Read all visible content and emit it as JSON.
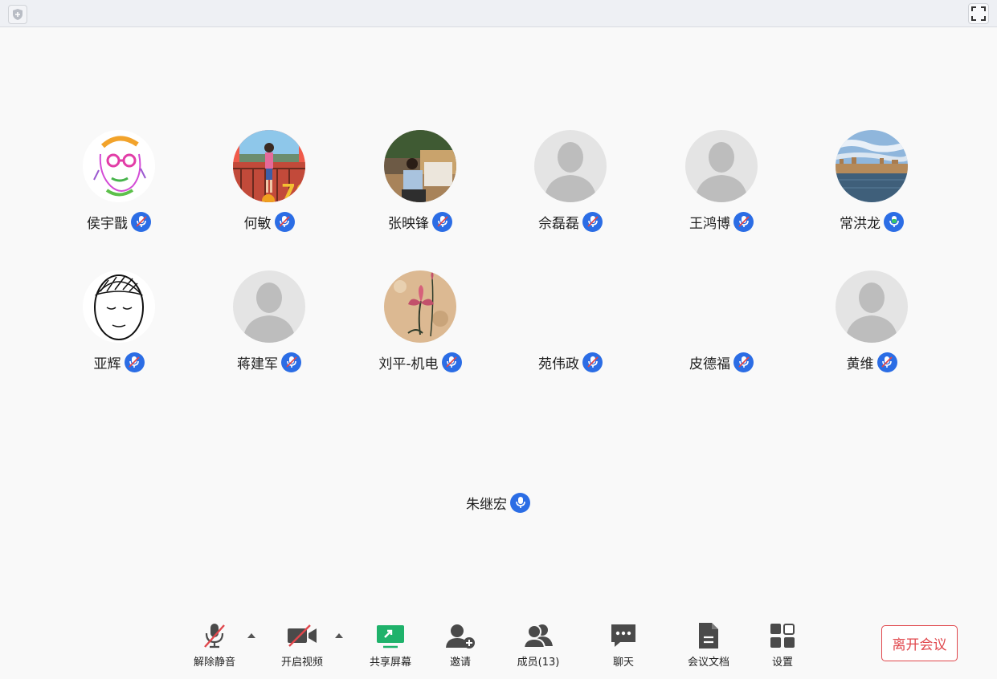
{
  "participants": [
    {
      "name": "侯宇戬",
      "mic": "muted",
      "avatar": "sketch-face-icon"
    },
    {
      "name": "何敏",
      "mic": "muted",
      "avatar": "photo-person-icon"
    },
    {
      "name": "张映锋",
      "mic": "muted",
      "avatar": "photo-person-icon"
    },
    {
      "name": "佘磊磊",
      "mic": "muted",
      "avatar": "default-avatar-icon"
    },
    {
      "name": "王鸿博",
      "mic": "muted",
      "avatar": "default-avatar-icon"
    },
    {
      "name": "常洪龙",
      "mic": "speaking",
      "avatar": "landscape-photo-icon"
    },
    {
      "name": "亚辉",
      "mic": "muted",
      "avatar": "drawn-face-icon"
    },
    {
      "name": "蒋建军",
      "mic": "muted",
      "avatar": "default-avatar-icon"
    },
    {
      "name": "刘平-机电",
      "mic": "muted",
      "avatar": "lotus-painting-icon"
    },
    {
      "name": "苑伟政",
      "mic": "muted",
      "avatar": "none"
    },
    {
      "name": "皮德福",
      "mic": "muted",
      "avatar": "none"
    },
    {
      "name": "黄维",
      "mic": "muted",
      "avatar": "default-avatar-icon"
    },
    {
      "name": "朱继宏",
      "mic": "on",
      "avatar": "none"
    }
  ],
  "toolbar": {
    "unmute": "解除静音",
    "start_video": "开启视频",
    "share_screen": "共享屏幕",
    "invite": "邀请",
    "members": "成员(13)",
    "chat": "聊天",
    "docs": "会议文档",
    "settings": "设置"
  },
  "leave_label": "离开会议",
  "colors": {
    "accent_blue": "#2b6de5",
    "speaking_green": "#35c46a",
    "danger_red": "#e0474c",
    "share_green": "#1fb26b"
  }
}
